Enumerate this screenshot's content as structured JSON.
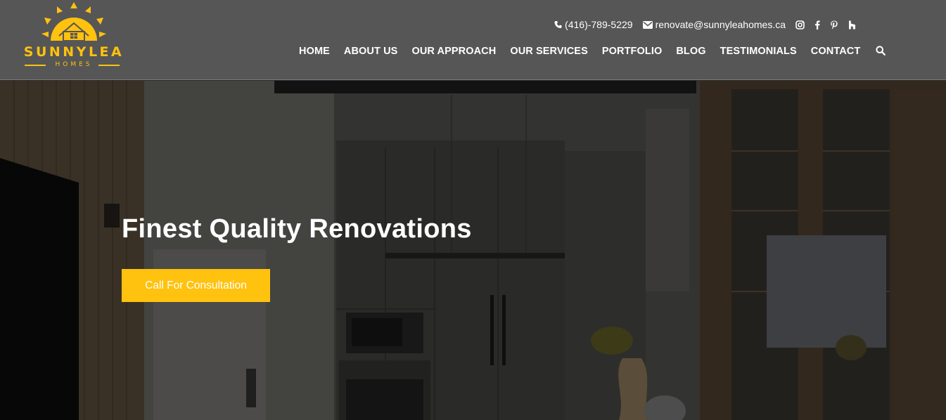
{
  "logo": {
    "word": "SUNNYLEA",
    "sub": "HOMES",
    "brand_color": "#ffc20e"
  },
  "topbar": {
    "phone": "(416)-789-5229",
    "email": "renovate@sunnyleahomes.ca",
    "social": [
      "instagram-icon",
      "facebook-icon",
      "pinterest-icon",
      "houzz-icon"
    ]
  },
  "nav": {
    "items": [
      "HOME",
      "ABOUT US",
      "OUR APPROACH",
      "OUR SERVICES",
      "PORTFOLIO",
      "BLOG",
      "TESTIMONIALS",
      "CONTACT"
    ],
    "search_icon": "search-icon"
  },
  "hero": {
    "title": "Finest Quality Renovations",
    "cta": "Call For Consultation"
  },
  "colors": {
    "header_bg": "#565656",
    "accent": "#ffc20e",
    "text": "#ffffff"
  }
}
